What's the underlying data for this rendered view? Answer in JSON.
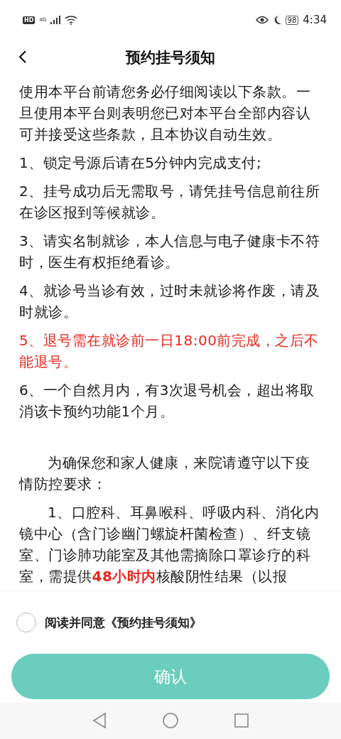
{
  "status_bar": {
    "hd_badge": "HD",
    "network": "4G",
    "battery": "98",
    "time": "4:34"
  },
  "header": {
    "title": "预约挂号须知"
  },
  "sections": [
    {
      "paragraphs": [
        {
          "kind": "plain",
          "text": "使用本平台前请您务必仔细阅读以下条款。一旦使用本平台则表明您已对本平台全部内容认可并接受这些条款，且本协议自动生效。"
        },
        {
          "kind": "plain",
          "text": "1、锁定号源后请在5分钟内完成支付;"
        },
        {
          "kind": "plain",
          "text": "2、挂号成功后无需取号，请凭挂号信息前往所在诊区报到等候就诊。"
        },
        {
          "kind": "plain",
          "text": "3、请实名制就诊，本人信息与电子健康卡不符时，医生有权拒绝看诊。"
        },
        {
          "kind": "plain",
          "text": "4、就诊号当诊有效，过时未就诊将作废，请及时就诊。"
        },
        {
          "kind": "warning",
          "text": "5、退号需在就诊前一日18:00前完成，之后不能退号。"
        },
        {
          "kind": "plain",
          "text": "6、一个自然月内，有3次退号机会，超出将取消该卡预约功能1个月。"
        }
      ]
    },
    {
      "paragraphs": [
        {
          "kind": "indented",
          "text": "为确保您和家人健康，来院请遵守以下疫情防控要求："
        },
        {
          "kind": "indented",
          "text": "1、口腔科、耳鼻喉科、呼吸内科、消化内镜中心（含门诊幽门螺旋杆菌检查）、纤支镜室、门诊肺功能室及其他需摘除口罩诊疗的科室，需提供**48小时内**核酸阴性结果（以报"
        }
      ]
    }
  ],
  "agree": {
    "label": "阅读并同意《预约挂号须知》",
    "checked": false
  },
  "confirm_button": {
    "label": "确认"
  }
}
